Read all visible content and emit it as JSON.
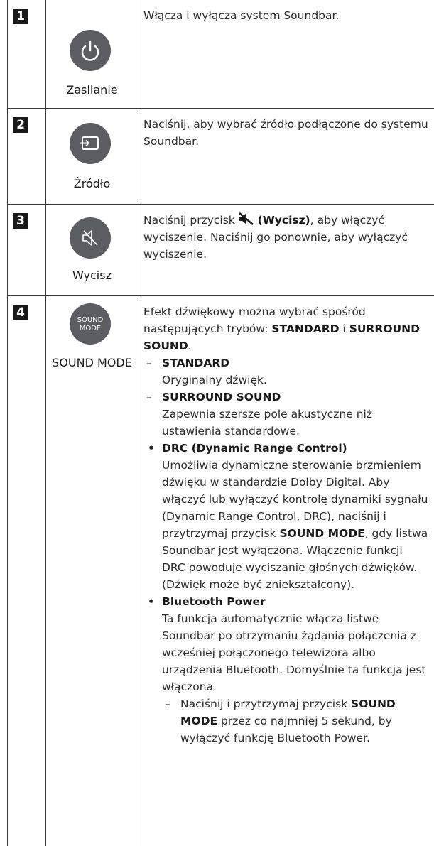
{
  "rows": [
    {
      "number": "1",
      "icon": "power-icon",
      "label": "Zasilanie",
      "description": "Włącza i wyłącza system Soundbar."
    },
    {
      "number": "2",
      "icon": "source-icon",
      "label": "Źródło",
      "description": "Naciśnij, aby wybrać źródło podłączone do systemu Soundbar."
    },
    {
      "number": "3",
      "icon": "mute-icon",
      "label": "Wycisz",
      "desc_pre": "Naciśnij przycisk ",
      "desc_bold": "(Wycisz)",
      "desc_post": ", aby włączyć wyciszenie. Naciśnij go ponownie, aby wyłączyć wyciszenie."
    },
    {
      "number": "4",
      "icon": "sound-mode-icon",
      "button_text_line1": "SOUND",
      "button_text_line2": "MODE",
      "label": "SOUND MODE",
      "intro_pre": "Efekt dźwiękowy można wybrać spośród następujących trybów: ",
      "intro_b1": "STANDARD",
      "intro_mid": " i ",
      "intro_b2": "SURROUND SOUND",
      "intro_post": ".",
      "modes": [
        {
          "name": "STANDARD",
          "text": "Oryginalny dźwięk."
        },
        {
          "name": "SURROUND SOUND",
          "text": "Zapewnia szersze pole akustyczne niż ustawienia standardowe."
        }
      ],
      "drc_title": "DRC (Dynamic Range Control)",
      "drc_pre": "Umożliwia dynamiczne sterowanie brzmieniem dźwięku w standardzie Dolby Digital. Aby włączyć lub wyłączyć kontrolę dynamiki sygnału (Dynamic Range Control, DRC), naciśnij i przytrzymaj przycisk ",
      "drc_bold": "SOUND MODE",
      "drc_post": ", gdy listwa Soundbar jest wyłączona. Włączenie funkcji DRC powoduje wyciszanie głośnych dźwięków. (Dźwięk może być zniekształcony).",
      "bt_title": "Bluetooth Power",
      "bt_text": "Ta funkcja automatycznie włącza listwę Soundbar po otrzymaniu żądania połączenia z wcześniej połączonego telewizora albo urządzenia Bluetooth. Domyślnie ta funkcja jest włączona.",
      "bt_note_pre": "Naciśnij i przytrzymaj przycisk ",
      "bt_note_bold": "SOUND MODE",
      "bt_note_post": " przez co najmniej 5 sekund, by wyłączyć funkcję Bluetooth Power."
    }
  ]
}
